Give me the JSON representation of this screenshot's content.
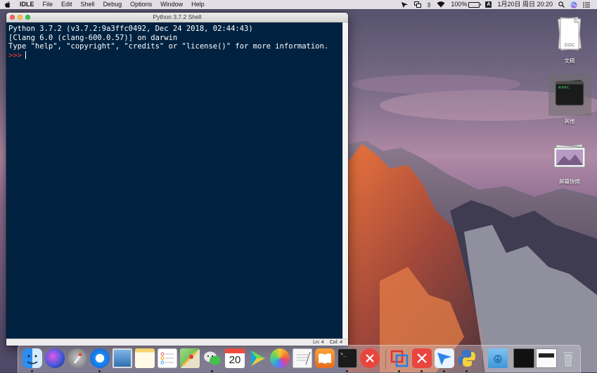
{
  "menubar": {
    "apple_icon": "apple-logo-icon",
    "app_name": "IDLE",
    "items": [
      "File",
      "Edit",
      "Shell",
      "Debug",
      "Options",
      "Window",
      "Help"
    ],
    "battery_percent": "100%",
    "input_method": "A",
    "datetime": "1月20日 周日 20:20",
    "tray_icons": [
      "kite-icon",
      "screens-icon",
      "bluetooth-icon",
      "wifi-icon",
      "battery-icon",
      "spotlight-search-icon",
      "siri-icon",
      "notification-center-icon"
    ]
  },
  "window": {
    "title": "Python 3.7.2 Shell",
    "shell_lines": [
      "Python 3.7.2 (v3.7.2:9a3ffc0492, Dec 24 2018, 02:44:43)",
      "[Clang 6.0 (clang-600.0.57)] on darwin",
      "Type \"help\", \"copyright\", \"credits\" or \"license()\" for more information."
    ],
    "prompt": ">>>",
    "status_ln": "Ln: 4",
    "status_col": "Col: 4",
    "colors": {
      "shell_background": "#002240",
      "prompt": "#ff3b30",
      "text": "#ffffff"
    }
  },
  "desktop": {
    "icons": [
      {
        "name": "doc-file-icon",
        "label": "文稿",
        "badge": "DOC"
      },
      {
        "name": "exec-file-icon",
        "label": "其他",
        "badge": "exec"
      },
      {
        "name": "screenshot-stack-icon",
        "label": "屏幕快照"
      }
    ]
  },
  "dock": {
    "apps": [
      "finder-icon",
      "siri-icon",
      "launchpad-icon",
      "safari-icon",
      "preview-icon",
      "notes-icon",
      "reminders-icon",
      "maps-icon",
      "wechat-icon",
      "calendar-icon",
      "infuse-icon",
      "photos-icon",
      "textedit-icon",
      "ibooks-icon",
      "terminal-icon",
      "xmind-icon",
      "parallels-icon",
      "xmind-zen-icon",
      "kite-icon",
      "python-launcher-icon"
    ],
    "calendar_day": "20",
    "right_items": [
      "downloads-folder-icon",
      "minimized-terminal-icon",
      "minimized-window-icon",
      "trash-icon"
    ]
  }
}
